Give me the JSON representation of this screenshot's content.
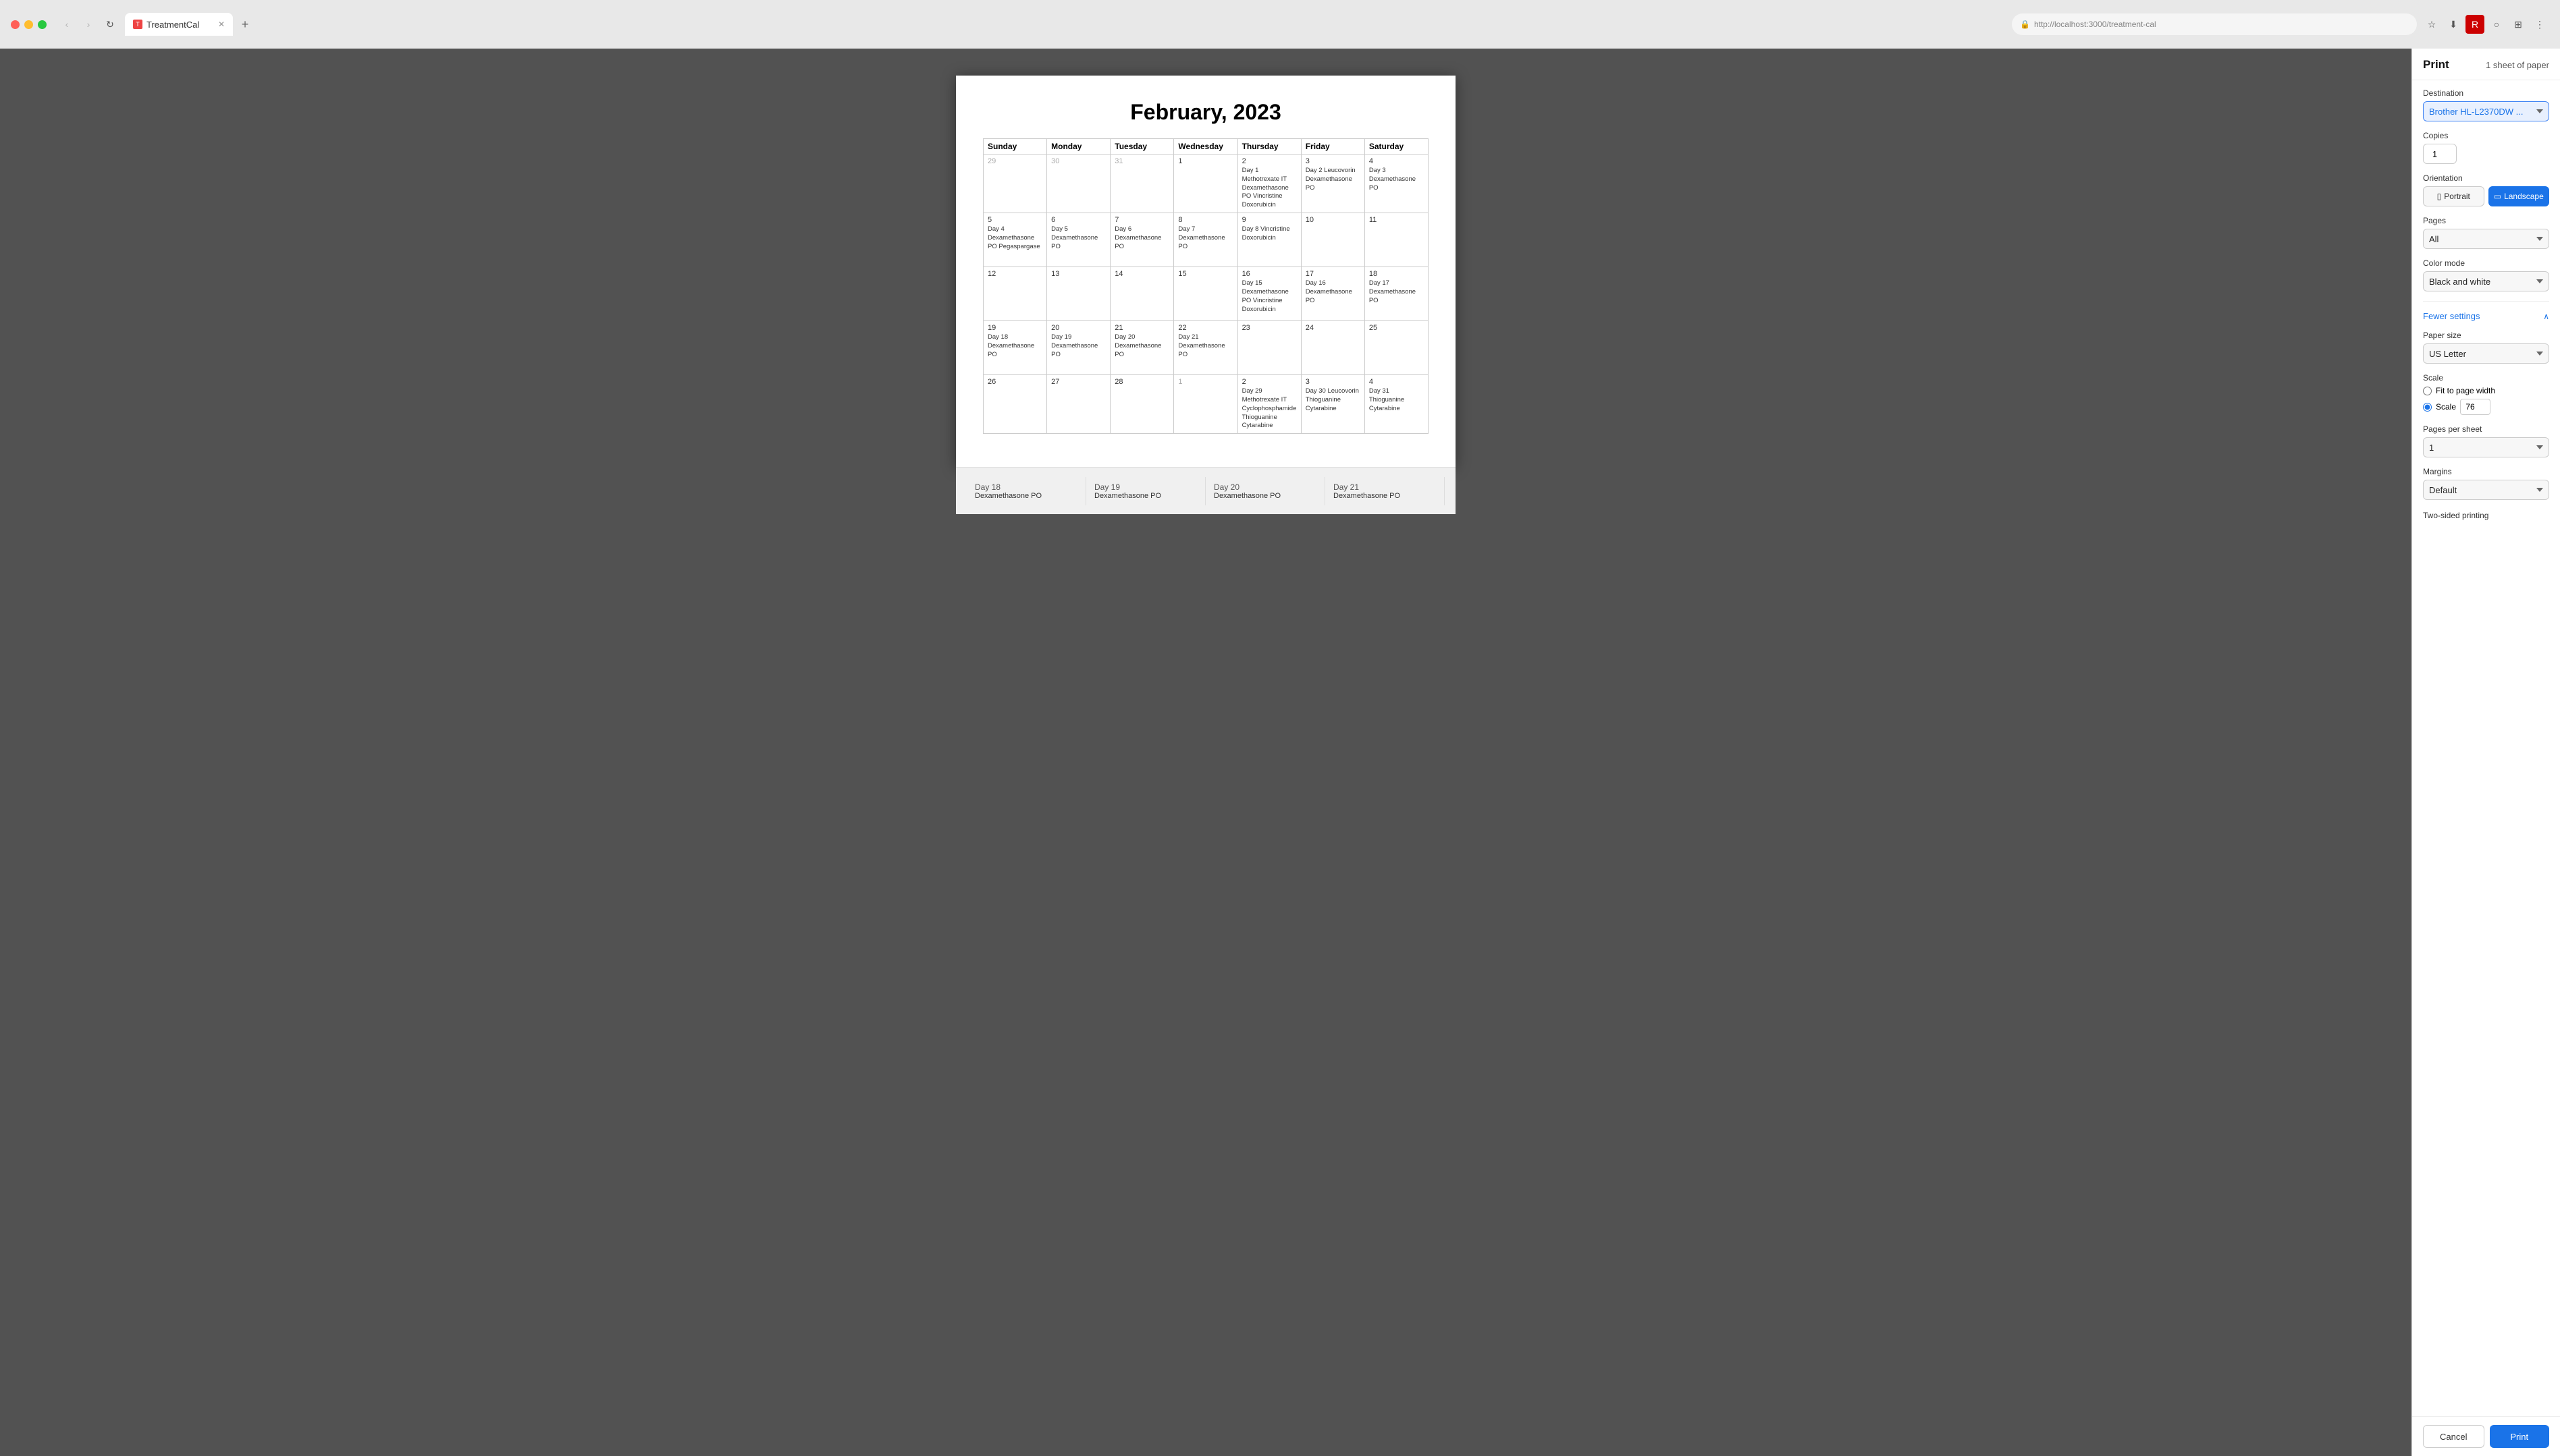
{
  "browser": {
    "tab_title": "TreatmentCal",
    "url": "http://localhost:3000/treatment-cal",
    "new_tab_label": "+",
    "nav": {
      "back": "‹",
      "forward": "›",
      "refresh": "↻"
    }
  },
  "print_panel": {
    "title": "Print",
    "sheet_count": "1 sheet of paper",
    "destination_label": "Destination",
    "destination_value": "Brother HL-L2370DW ...",
    "copies_label": "Copies",
    "copies_value": "1",
    "orientation_label": "Orientation",
    "orientation_portrait": "Portrait",
    "orientation_landscape": "Landscape",
    "pages_label": "Pages",
    "pages_value": "All",
    "color_mode_label": "Color mode",
    "color_mode_value": "Black and white",
    "fewer_settings_label": "Fewer settings",
    "paper_size_label": "Paper size",
    "paper_size_value": "US Letter",
    "scale_label": "Scale",
    "fit_to_page_label": "Fit to page width",
    "scale_radio_label": "Scale",
    "scale_value": "76",
    "pages_per_sheet_label": "Pages per sheet",
    "pages_per_sheet_value": "1",
    "margins_label": "Margins",
    "margins_value": "Default",
    "two_sided_label": "Two-sided printing",
    "cancel_label": "Cancel",
    "print_label": "Print"
  },
  "calendar": {
    "title": "February, 2023",
    "days_of_week": [
      "Sunday",
      "Monday",
      "Tuesday",
      "Wednesday",
      "Thursday",
      "Friday",
      "Saturday"
    ],
    "weeks": [
      [
        {
          "num": "29",
          "events": "",
          "out": true
        },
        {
          "num": "30",
          "events": "",
          "out": true
        },
        {
          "num": "31",
          "events": "",
          "out": true
        },
        {
          "num": "1",
          "events": ""
        },
        {
          "num": "2",
          "events": "Day 1\nMethotrexate IT\nDexamethasone PO\nVincristine\nDoxorubicin"
        },
        {
          "num": "3",
          "events": "Day 2\nLeucovorin\nDexamethasone PO"
        },
        {
          "num": "4",
          "events": "Day 3\nDexamethasone PO"
        }
      ],
      [
        {
          "num": "5",
          "events": "Day 4\nDexamethasone PO\nPegaspargase"
        },
        {
          "num": "6",
          "events": "Day 5\nDexamethasone PO"
        },
        {
          "num": "7",
          "events": "Day 6\nDexamethasone PO"
        },
        {
          "num": "8",
          "events": "Day 7\nDexamethasone PO"
        },
        {
          "num": "9",
          "events": "Day 8\nVincristine\nDoxorubicin"
        },
        {
          "num": "10",
          "events": ""
        },
        {
          "num": "11",
          "events": ""
        }
      ],
      [
        {
          "num": "12",
          "events": ""
        },
        {
          "num": "13",
          "events": ""
        },
        {
          "num": "14",
          "events": ""
        },
        {
          "num": "15",
          "events": ""
        },
        {
          "num": "16",
          "events": "Day 15\nDexamethasone PO\nVincristine\nDoxorubicin"
        },
        {
          "num": "17",
          "events": "Day 16\nDexamethasone PO"
        },
        {
          "num": "18",
          "events": "Day 17\nDexamethasone PO"
        }
      ],
      [
        {
          "num": "19",
          "events": "Day 18\nDexamethasone PO"
        },
        {
          "num": "20",
          "events": "Day 19\nDexamethasone PO"
        },
        {
          "num": "21",
          "events": "Day 20\nDexamethasone PO"
        },
        {
          "num": "22",
          "events": "Day 21\nDexamethasone PO"
        },
        {
          "num": "23",
          "events": ""
        },
        {
          "num": "24",
          "events": ""
        },
        {
          "num": "25",
          "events": ""
        }
      ],
      [
        {
          "num": "26",
          "events": ""
        },
        {
          "num": "27",
          "events": ""
        },
        {
          "num": "28",
          "events": ""
        },
        {
          "num": "1",
          "events": "",
          "out": true
        },
        {
          "num": "2",
          "events": "Day 29\nMethotrexate IT\nCyclophosphamide\nThioguanine\nCytarabine"
        },
        {
          "num": "3",
          "events": "Day 30\nLeucovorin\nThioguanine\nCytarabine"
        },
        {
          "num": "4",
          "events": "Day 31\nThioguanine\nCytarabine"
        }
      ]
    ]
  },
  "bottom_strip": {
    "items": [
      {
        "day_label": "Day 18",
        "event": "Dexamethasone PO"
      },
      {
        "day_label": "Day 19",
        "event": "Dexamethasone PO"
      },
      {
        "day_label": "Day 20",
        "event": "Dexamethasone PO"
      },
      {
        "day_label": "Day 21",
        "event": "Dexamethasone PO"
      }
    ]
  }
}
